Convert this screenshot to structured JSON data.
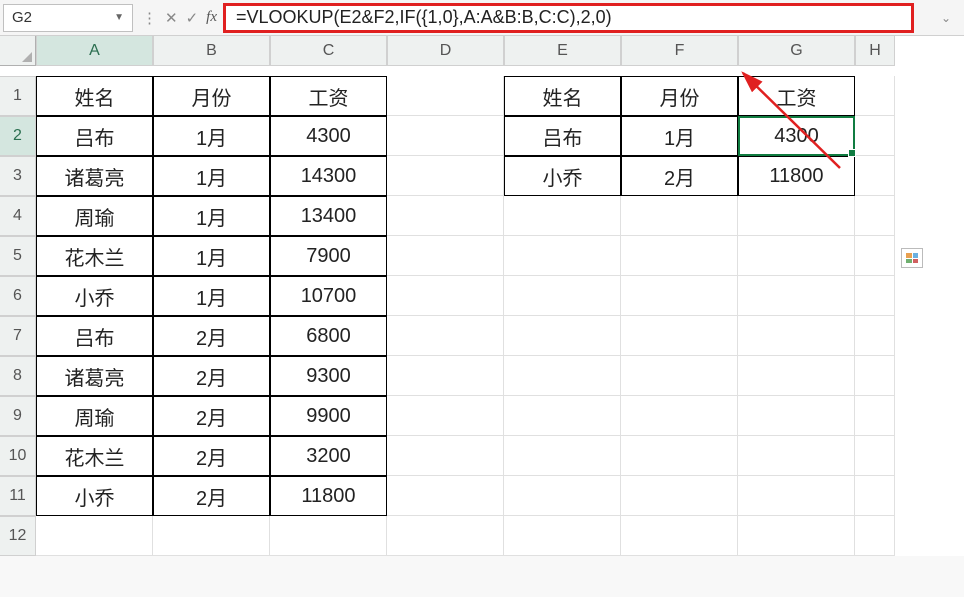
{
  "nameBox": "G2",
  "formula": "=VLOOKUP(E2&F2,IF({1,0},A:A&B:B,C:C),2,0)",
  "columns": [
    "A",
    "B",
    "C",
    "D",
    "E",
    "F",
    "G",
    "H"
  ],
  "rows": [
    "1",
    "2",
    "3",
    "4",
    "5",
    "6",
    "7",
    "8",
    "9",
    "10",
    "11",
    "12"
  ],
  "table1": {
    "header": {
      "A": "姓名",
      "B": "月份",
      "C": "工资"
    },
    "rows": [
      {
        "A": "吕布",
        "B": "1月",
        "C": "4300"
      },
      {
        "A": "诸葛亮",
        "B": "1月",
        "C": "14300"
      },
      {
        "A": "周瑜",
        "B": "1月",
        "C": "13400"
      },
      {
        "A": "花木兰",
        "B": "1月",
        "C": "7900"
      },
      {
        "A": "小乔",
        "B": "1月",
        "C": "10700"
      },
      {
        "A": "吕布",
        "B": "2月",
        "C": "6800"
      },
      {
        "A": "诸葛亮",
        "B": "2月",
        "C": "9300"
      },
      {
        "A": "周瑜",
        "B": "2月",
        "C": "9900"
      },
      {
        "A": "花木兰",
        "B": "2月",
        "C": "3200"
      },
      {
        "A": "小乔",
        "B": "2月",
        "C": "11800"
      }
    ]
  },
  "table2": {
    "header": {
      "E": "姓名",
      "F": "月份",
      "G": "工资"
    },
    "rows": [
      {
        "E": "吕布",
        "F": "1月",
        "G": "4300"
      },
      {
        "E": "小乔",
        "F": "2月",
        "G": "11800"
      }
    ]
  },
  "activeCell": "G2"
}
